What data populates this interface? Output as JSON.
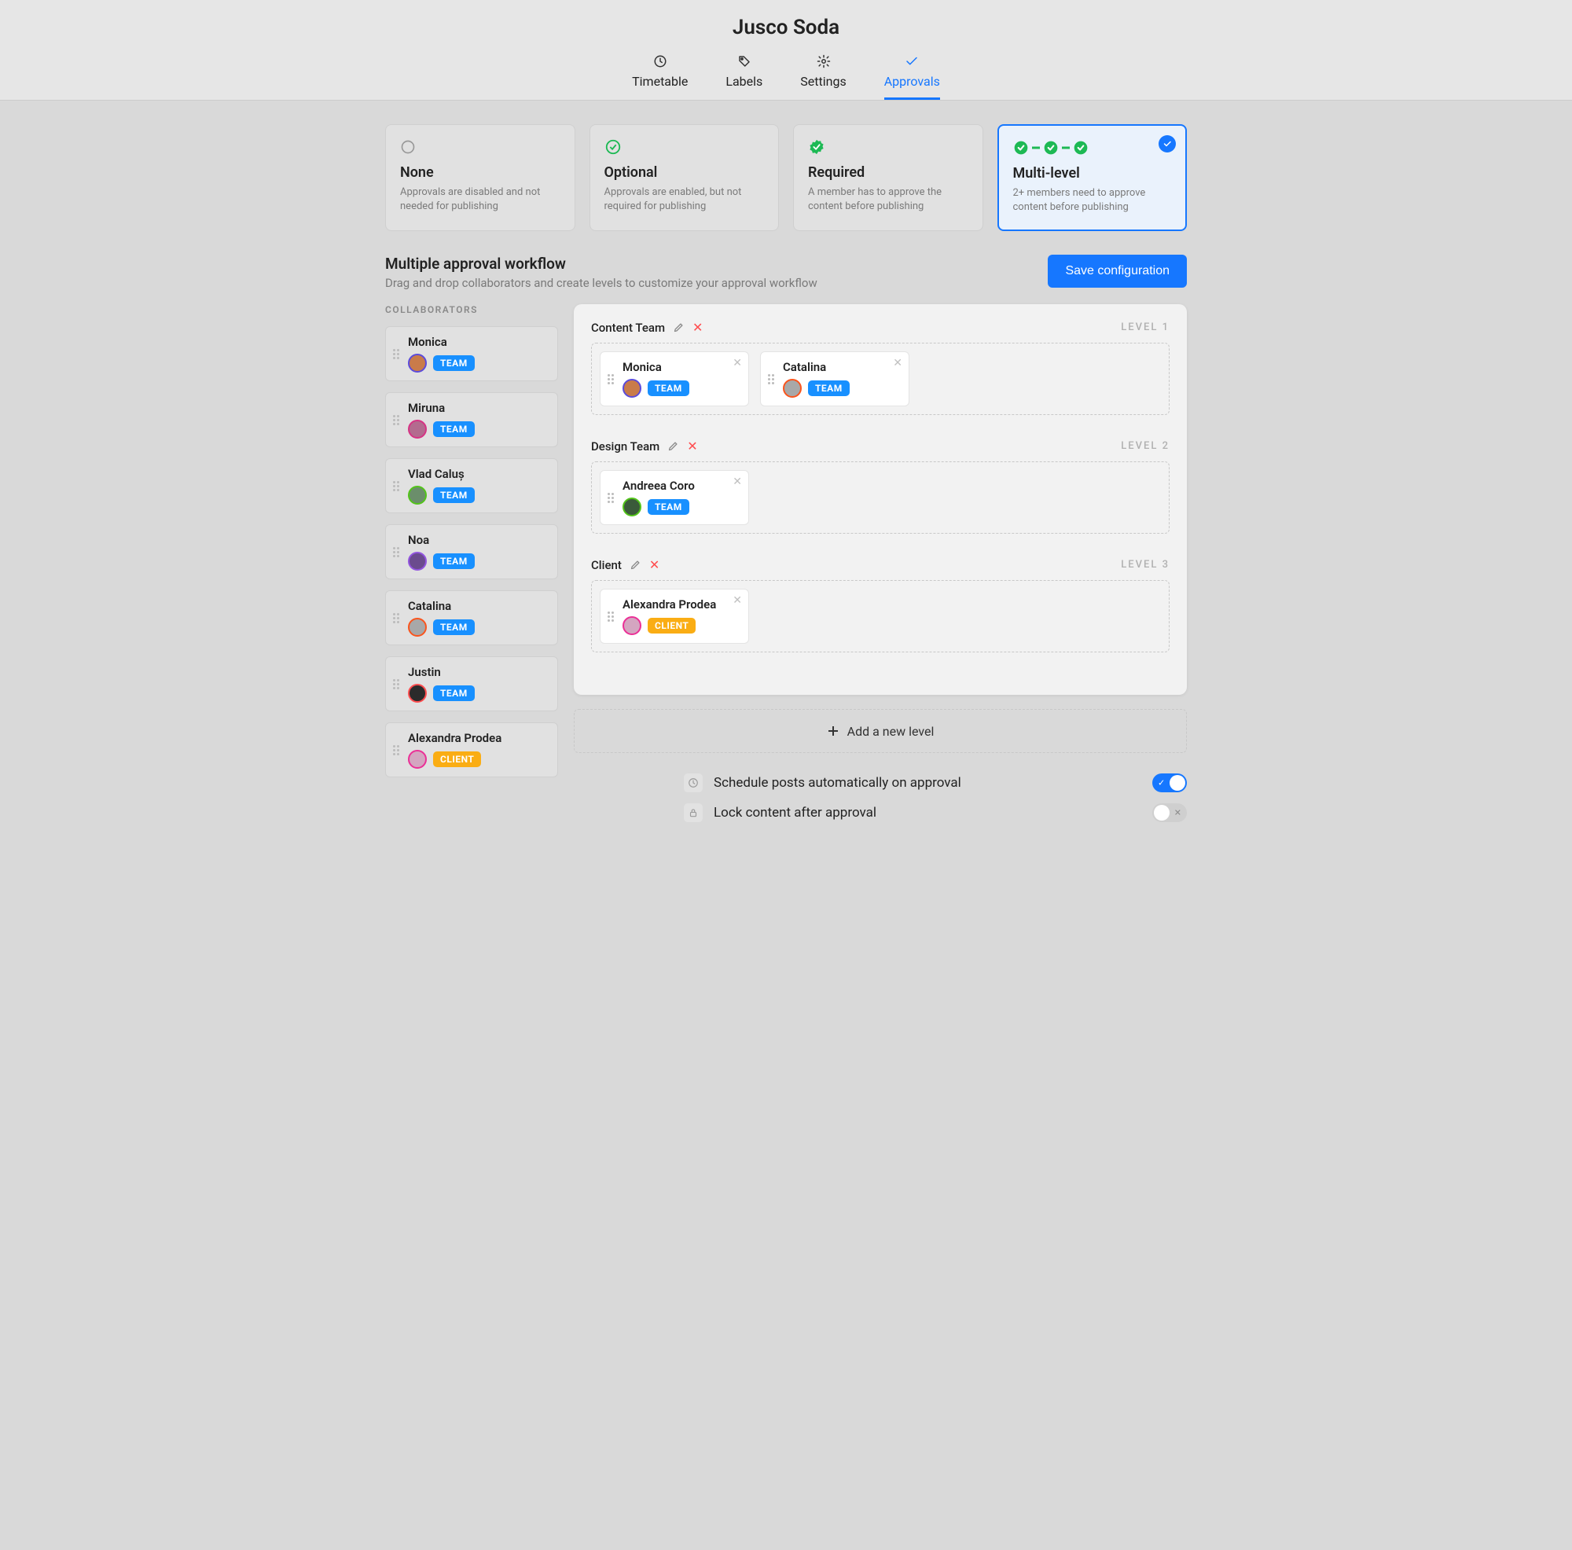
{
  "title": "Jusco Soda",
  "tabs": [
    {
      "id": "timetable",
      "label": "Timetable",
      "icon": "clock"
    },
    {
      "id": "labels",
      "label": "Labels",
      "icon": "tag"
    },
    {
      "id": "settings",
      "label": "Settings",
      "icon": "gear"
    },
    {
      "id": "approvals",
      "label": "Approvals",
      "icon": "check",
      "active": true
    }
  ],
  "options": [
    {
      "id": "none",
      "title": "None",
      "desc": "Approvals are disabled and not needed for publishing",
      "icon": "circle-hollow",
      "selected": false
    },
    {
      "id": "optional",
      "title": "Optional",
      "desc": "Approvals are enabled, but not required for publishing",
      "icon": "check-green-outline",
      "selected": false
    },
    {
      "id": "required",
      "title": "Required",
      "desc": "A member has to approve the content before publishing",
      "icon": "check-green-burst",
      "selected": false
    },
    {
      "id": "multi",
      "title": "Multi-level",
      "desc": "2+ members need to approve content before publishing",
      "icon": "check-chain",
      "selected": true
    }
  ],
  "workflow": {
    "heading": "Multiple approval workflow",
    "sub": "Drag and drop collaborators and create levels to customize your approval workflow",
    "save_label": "Save configuration",
    "collaborators_heading": "COLLABORATORS",
    "add_level_label": "Add a new level"
  },
  "collaborators": [
    {
      "name": "Monica",
      "role": "TEAM",
      "avatar_bg": "#c97b4a",
      "avatar_ring": "#5b4bdb"
    },
    {
      "name": "Miruna",
      "role": "TEAM",
      "avatar_bg": "#b36b8f",
      "avatar_ring": "#d63384"
    },
    {
      "name": "Vlad Caluș",
      "role": "TEAM",
      "avatar_bg": "#6b8e6b",
      "avatar_ring": "#52c41a"
    },
    {
      "name": "Noa",
      "role": "TEAM",
      "avatar_bg": "#6b4b8e",
      "avatar_ring": "#9254de"
    },
    {
      "name": "Catalina",
      "role": "TEAM",
      "avatar_bg": "#a8a8a8",
      "avatar_ring": "#fa541c"
    },
    {
      "name": "Justin",
      "role": "TEAM",
      "avatar_bg": "#2b2b2b",
      "avatar_ring": "#ff4d4f"
    },
    {
      "name": "Alexandra Prodea",
      "role": "CLIENT",
      "avatar_bg": "#d4a5c0",
      "avatar_ring": "#eb2f96"
    }
  ],
  "levels": [
    {
      "name": "Content Team",
      "tag": "LEVEL 1",
      "members": [
        {
          "name": "Monica",
          "role": "TEAM",
          "avatar_bg": "#c97b4a",
          "avatar_ring": "#5b4bdb"
        },
        {
          "name": "Catalina",
          "role": "TEAM",
          "avatar_bg": "#a8a8a8",
          "avatar_ring": "#fa541c"
        }
      ]
    },
    {
      "name": "Design Team",
      "tag": "LEVEL 2",
      "members": [
        {
          "name": "Andreea Coro",
          "role": "TEAM",
          "avatar_bg": "#3a5a3a",
          "avatar_ring": "#52c41a"
        }
      ]
    },
    {
      "name": "Client",
      "tag": "LEVEL 3",
      "members": [
        {
          "name": "Alexandra Prodea",
          "role": "CLIENT",
          "avatar_bg": "#d4a5c0",
          "avatar_ring": "#eb2f96"
        }
      ]
    }
  ],
  "settings": [
    {
      "icon": "clock",
      "label": "Schedule posts automatically on approval",
      "on": true
    },
    {
      "icon": "lock",
      "label": "Lock content after approval",
      "on": false
    }
  ]
}
